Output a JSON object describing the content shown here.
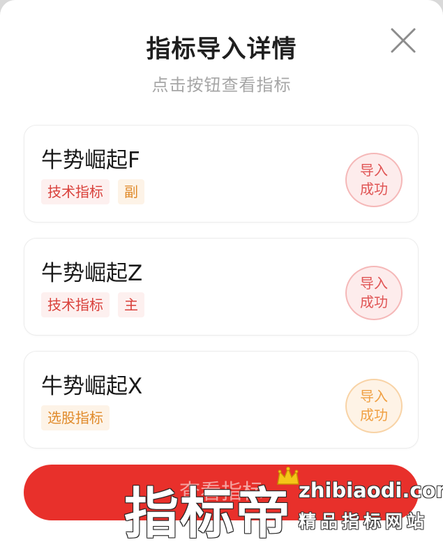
{
  "dialog": {
    "title": "指标导入详情",
    "subtitle": "点击按钮查看指标"
  },
  "cards": [
    {
      "name": "牛势崛起F",
      "tags": [
        "技术指标",
        "副"
      ],
      "status": [
        "导入",
        "成功"
      ]
    },
    {
      "name": "牛势崛起Z",
      "tags": [
        "技术指标",
        "主"
      ],
      "status": [
        "导入",
        "成功"
      ]
    },
    {
      "name": "牛势崛起X",
      "tags": [
        "选股指标"
      ],
      "status": [
        "导入",
        "成功"
      ]
    }
  ],
  "view_button": {
    "label": "查看指标"
  },
  "watermark": {
    "main": "指标帝",
    "url": "zhibiaodi.com",
    "slogan": "精品指标网站"
  },
  "colors": {
    "accent_red": "#e8302b",
    "tag_red": "#d9403a",
    "tag_orange": "#e08a2a",
    "stamp_orange": "#f0a043"
  },
  "icons": {
    "close": "close-icon",
    "crown": "crown-icon"
  }
}
